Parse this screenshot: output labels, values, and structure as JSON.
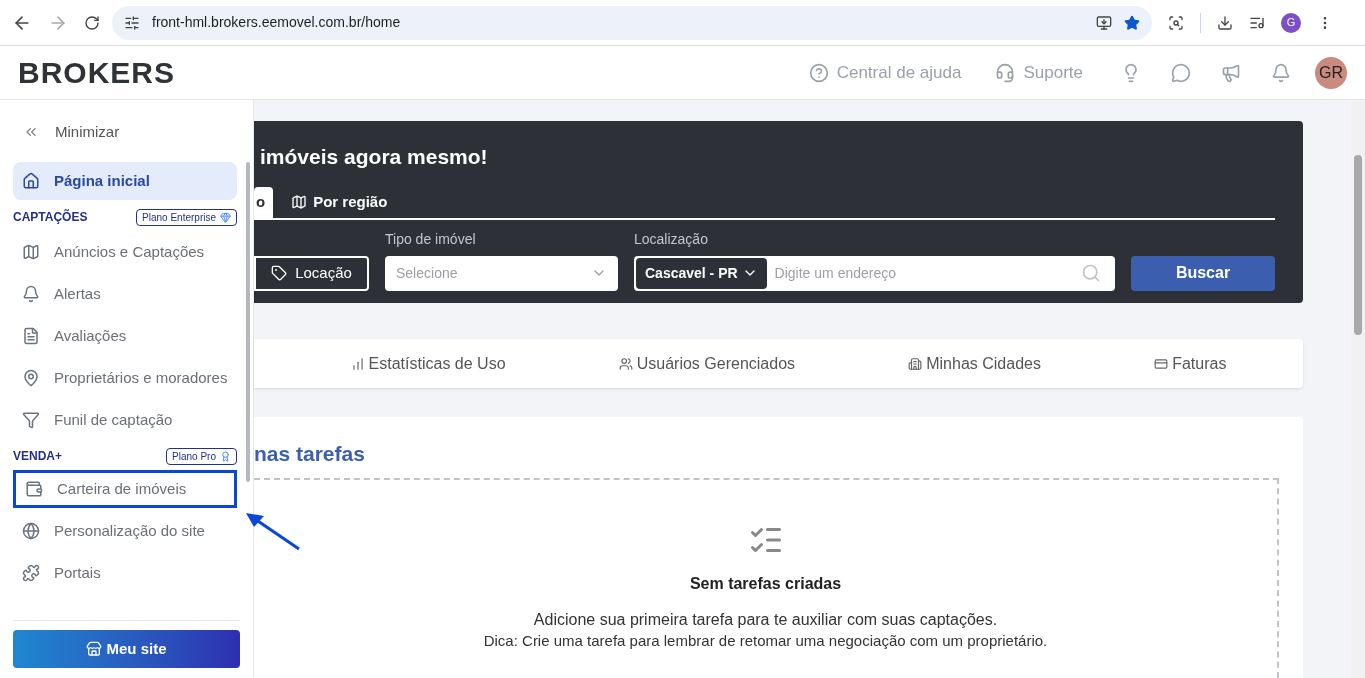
{
  "browser": {
    "url": "front-hml.brokers.eemovel.com.br/home",
    "bookmarked": true,
    "profile_initial": "G"
  },
  "header": {
    "logo": "BROKERS",
    "links": [
      {
        "label": "Central de ajuda"
      },
      {
        "label": "Suporte"
      }
    ],
    "avatar": "GR"
  },
  "sidebar": {
    "minimize": "Minimizar",
    "home": {
      "label": "Página inicial",
      "selected": true
    },
    "sections": [
      {
        "title": "CAPTAÇÕES",
        "badge": "Plano Enterprise",
        "items": [
          {
            "label": "Anúncios e Captações",
            "selected": false,
            "annotated": false
          },
          {
            "label": "Alertas",
            "selected": false,
            "annotated": false
          },
          {
            "label": "Avaliações",
            "selected": false,
            "annotated": false
          },
          {
            "label": "Proprietários e moradores",
            "selected": false,
            "annotated": false
          },
          {
            "label": "Funil de captação",
            "selected": false,
            "annotated": false
          }
        ]
      },
      {
        "title": "VENDA+",
        "badge": "Plano Pro",
        "items": [
          {
            "label": "Carteira de imóveis",
            "selected": false,
            "annotated": true
          },
          {
            "label": "Personalização do site",
            "selected": false,
            "annotated": false
          },
          {
            "label": "Portais",
            "selected": false,
            "annotated": false
          }
        ]
      }
    ],
    "site_button": "Meu site"
  },
  "hero": {
    "title": "imóveis agora mesmo!",
    "tabs": [
      {
        "label": "o",
        "selected": true
      },
      {
        "label": "Por região",
        "selected": false
      }
    ],
    "deal_button": "Locação",
    "type_label": "Tipo de imóvel",
    "type_placeholder": "Selecione",
    "location_label": "Localização",
    "city": "Cascavel - PR",
    "address_placeholder": "Digite um endereço",
    "search_button": "Buscar"
  },
  "nav": [
    {
      "label": "Estatísticas de Uso"
    },
    {
      "label": "Usuários Gerenciados"
    },
    {
      "label": "Minhas Cidades"
    },
    {
      "label": "Faturas"
    }
  ],
  "tasks": {
    "title": "nas tarefas",
    "empty_title": "Sem tarefas criadas",
    "empty_text": "Adicione sua primeira tarefa para te auxiliar com suas captações.",
    "tip": "Dica: Crie uma tarefa para lembrar de retomar uma negociação com um proprietário."
  }
}
